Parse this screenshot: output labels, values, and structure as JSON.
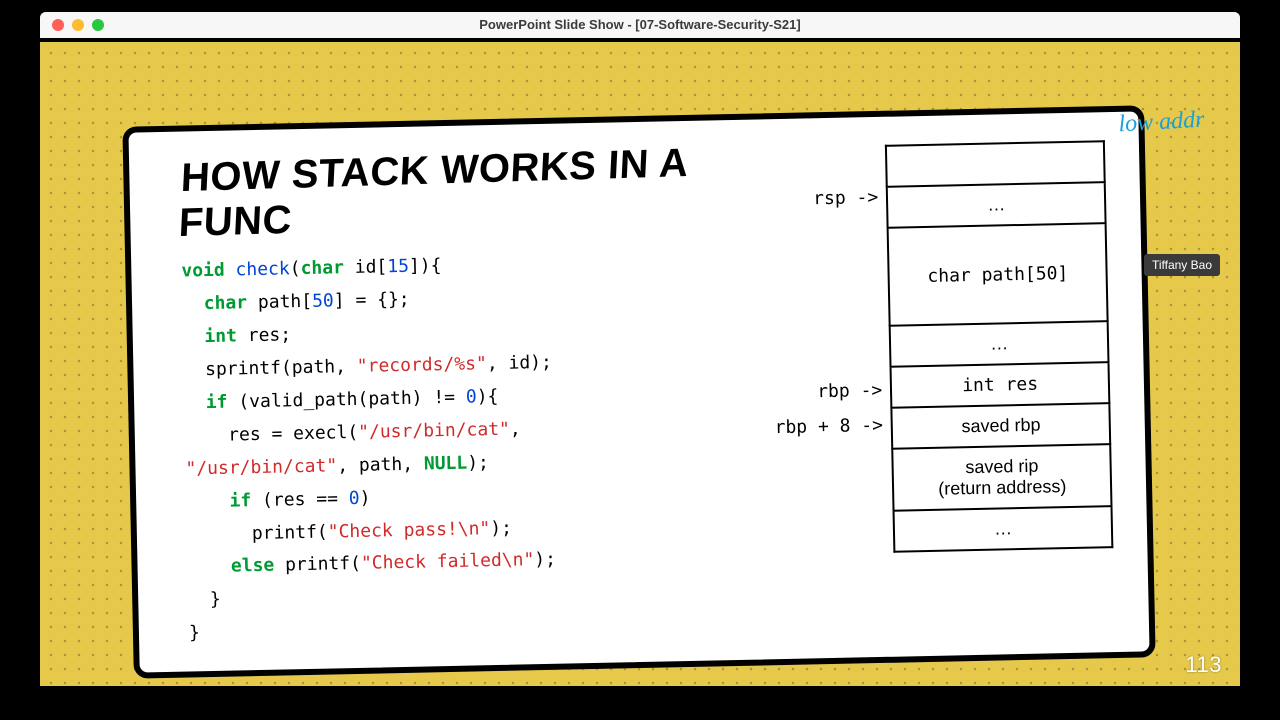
{
  "window": {
    "title": "PowerPoint Slide Show - [07-Software-Security-S21]"
  },
  "slide": {
    "title": "HOW STACK WORKS IN A FUNC",
    "page_number": "113"
  },
  "code": {
    "l1_void": "void",
    "l1_fn": "check",
    "l1_char": "char",
    "l1_id": " id[",
    "l1_num": "15",
    "l1_close": "]){",
    "l2_char": "char",
    "l2_rest": " path[",
    "l2_num": "50",
    "l2_close": "] = {};",
    "l3_int": "int",
    "l3_rest": " res;",
    "l4": "sprintf(path, ",
    "l4_str": "\"records/%s\"",
    "l4_end": ", id);",
    "l5_if": "if",
    "l5_body": " (valid_path(path) != ",
    "l5_num": "0",
    "l5_close": "){",
    "l6_a": "res = execl(",
    "l6_str1": "\"/usr/bin/cat\"",
    "l6_c": ",",
    "l7_str2": "\"/usr/bin/cat\"",
    "l7_mid": ", path, ",
    "l7_null": "NULL",
    "l7_end": ");",
    "l8_if": "if",
    "l8_body": " (res == ",
    "l8_num": "0",
    "l8_close": ")",
    "l9_a": "printf(",
    "l9_str": "\"Check pass!\\n\"",
    "l9_end": ");",
    "l10_else": "else",
    "l10_pr": " printf(",
    "l10_str": "\"Check failed\\n\"",
    "l10_end": ");",
    "l11": "}",
    "l12": "}"
  },
  "pointers": {
    "rsp": "rsp ->",
    "rbp": "rbp ->",
    "rbp8": "rbp + 8 ->"
  },
  "stack": {
    "row0": "",
    "row1": "…",
    "row2": "char path[50]",
    "row3": "…",
    "row4": "int res",
    "row5_a": "saved",
    "row5_b": " rbp",
    "row6_a": "saved",
    "row6_b": " rip",
    "row6_c": "(return address)",
    "row7": "…"
  },
  "annotation": {
    "low_addr": "low addr",
    "presenter": "Tiffany Bao"
  }
}
